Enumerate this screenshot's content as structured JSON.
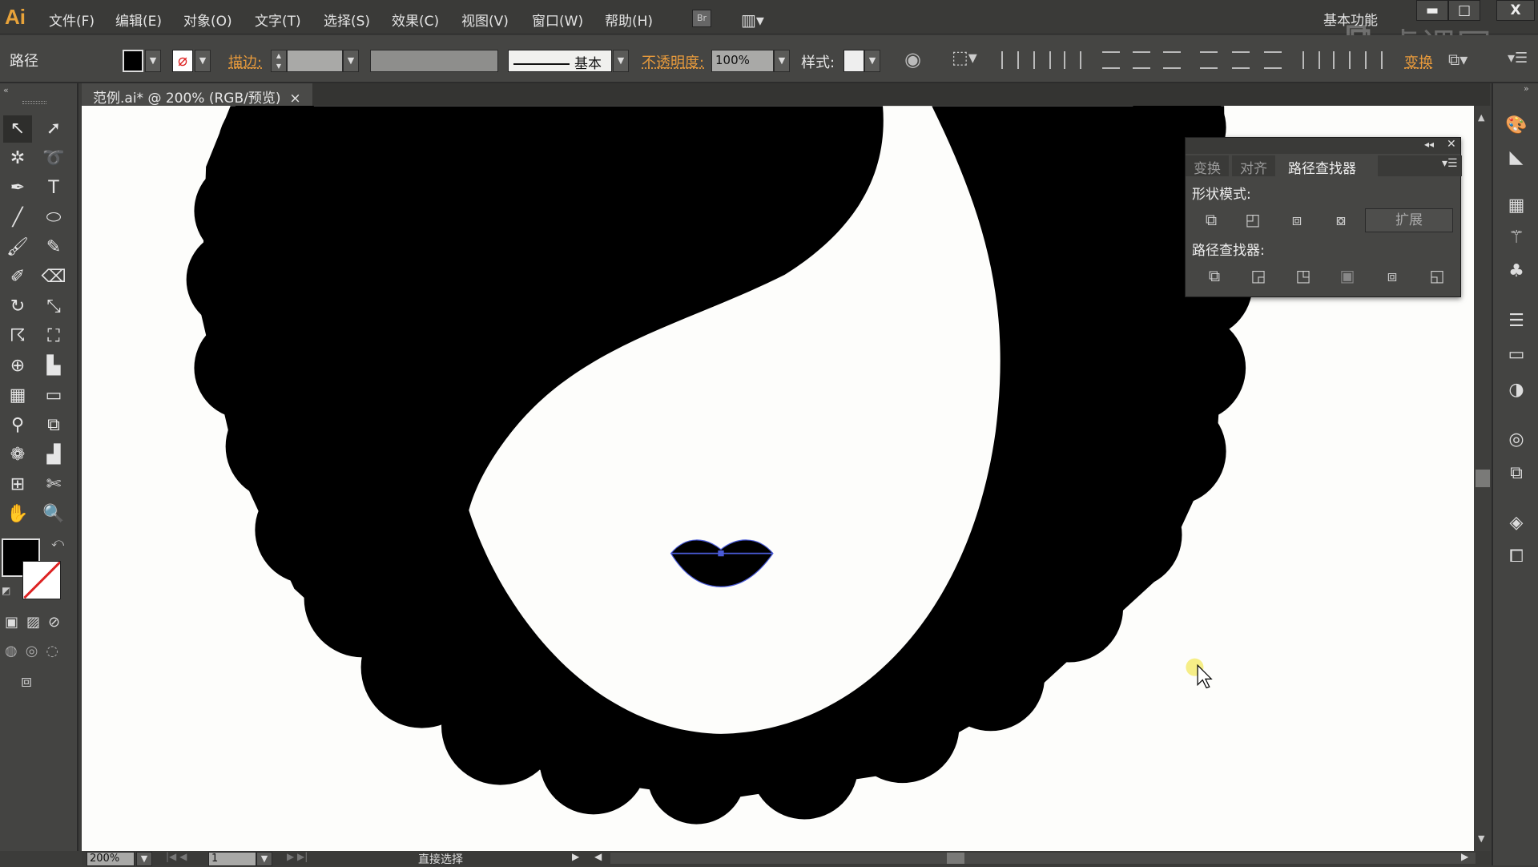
{
  "app": {
    "logo": "Ai",
    "workspace": "基本功能",
    "bridge": "Br",
    "watermark": "虎课网"
  },
  "menu": [
    "文件(F)",
    "编辑(E)",
    "对象(O)",
    "文字(T)",
    "选择(S)",
    "效果(C)",
    "视图(V)",
    "窗口(W)",
    "帮助(H)"
  ],
  "window_controls": {
    "minimize": "▬",
    "maximize": "□",
    "close": "X"
  },
  "control": {
    "selection_type": "路径",
    "stroke_label": "描边:",
    "stroke_profile": "基本",
    "opacity_label": "不透明度:",
    "opacity_value": "100%",
    "style_label": "样式:",
    "transform_label": "变换",
    "fill_color": "#000000",
    "stroke": "none"
  },
  "document_tab": {
    "title": "范例.ai* @ 200% (RGB/预览)",
    "close": "×"
  },
  "pathfinder_panel": {
    "tabs": [
      "变换",
      "对齐",
      "路径查找器"
    ],
    "active_tab": "路径查找器",
    "shape_modes_label": "形状模式:",
    "expand_button": "扩展",
    "pathfinders_label": "路径查找器:"
  },
  "status": {
    "zoom": "200%",
    "artboard": "1",
    "tool": "直接选择"
  },
  "colors": {
    "accent": "#e79a3c",
    "canvas": "#fdfdfb",
    "art": "#000000",
    "path_selection": "#4a5bd8"
  }
}
